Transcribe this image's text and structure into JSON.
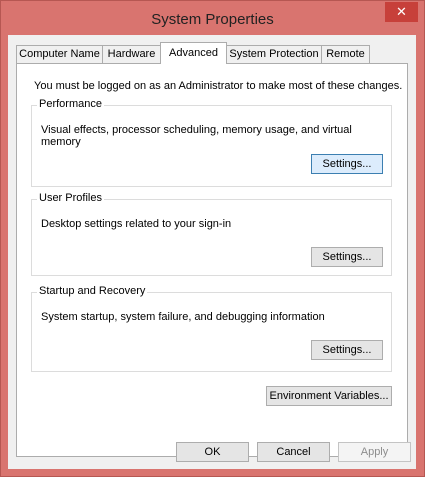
{
  "window": {
    "title": "System Properties",
    "close_glyph": "✕"
  },
  "tabs": [
    {
      "label": "Computer Name"
    },
    {
      "label": "Hardware"
    },
    {
      "label": "Advanced"
    },
    {
      "label": "System Protection"
    },
    {
      "label": "Remote"
    }
  ],
  "active_tab": "Advanced",
  "admin_note": "You must be logged on as an Administrator to make most of these changes.",
  "groups": {
    "performance": {
      "label": "Performance",
      "description": "Visual effects, processor scheduling, memory usage, and virtual memory",
      "button": "Settings..."
    },
    "user_profiles": {
      "label": "User Profiles",
      "description": "Desktop settings related to your sign-in",
      "button": "Settings..."
    },
    "startup_recovery": {
      "label": "Startup and Recovery",
      "description": "System startup, system failure, and debugging information",
      "button": "Settings..."
    }
  },
  "env_button": "Environment Variables...",
  "footer": {
    "ok": "OK",
    "cancel": "Cancel",
    "apply": "Apply"
  },
  "colors": {
    "frame": "#d9746f",
    "close": "#c7403a",
    "focus_border": "#3c7fb1"
  }
}
